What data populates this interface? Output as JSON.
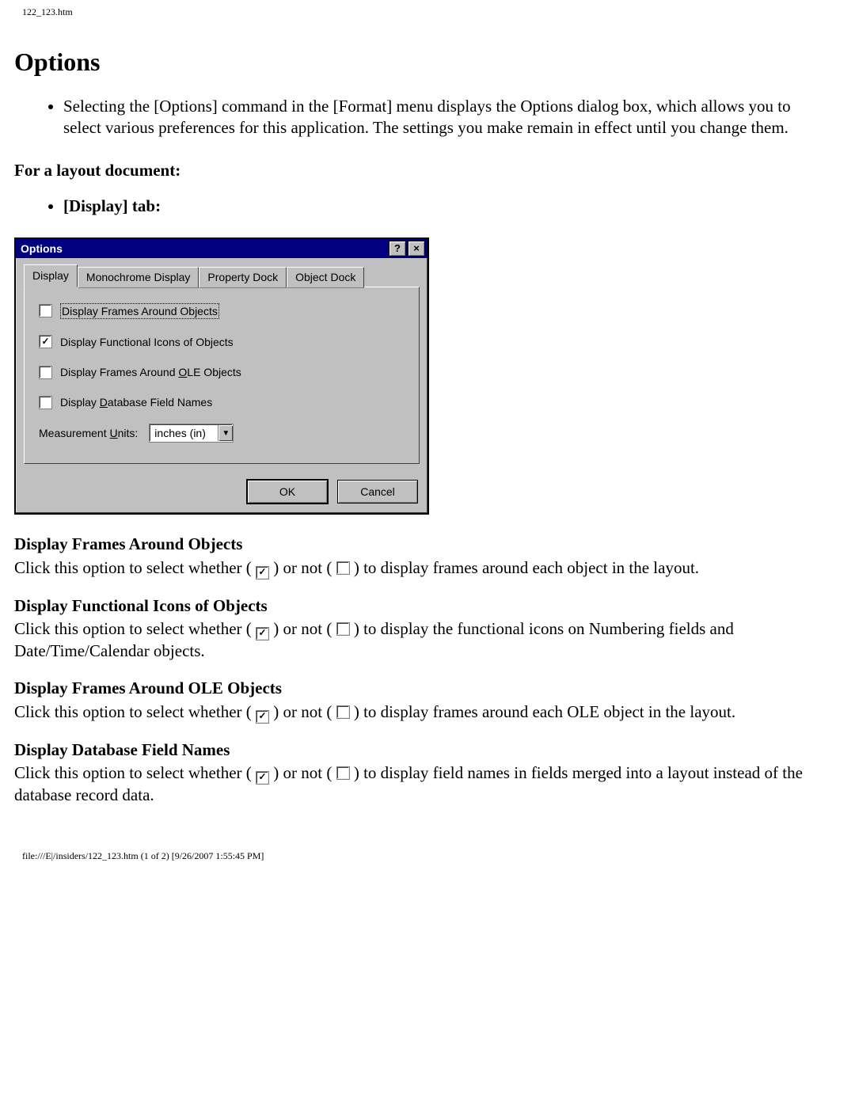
{
  "path_top": "122_123.htm",
  "title": "Options",
  "intro": "Selecting the [Options] command in the [Format] menu displays the Options dialog box, which allows you to select various preferences for this application. The settings you make remain in effect until you change them.",
  "subhead": "For a layout document:",
  "bullet_tab": "[Display] tab:",
  "dialog": {
    "title": "Options",
    "help": "?",
    "close": "×",
    "tabs": [
      "Display",
      "Monochrome Display",
      "Property Dock",
      "Object Dock"
    ],
    "opts": {
      "frames_objects": "Display Frames Around Objects",
      "func_icons": "Display Functional Icons of Objects",
      "frames_ole_pre": "Display Frames Around ",
      "frames_ole_u": "O",
      "frames_ole_post": "LE Objects",
      "db_pre": "Display ",
      "db_u": "D",
      "db_post": "atabase Field Names"
    },
    "units_label_pre": "Measurement ",
    "units_label_u": "U",
    "units_label_post": "nits:",
    "units_value": "inches (in)",
    "ok": "OK",
    "cancel": "Cancel"
  },
  "check_mark": "✓",
  "sections": [
    {
      "h": "Display Frames Around Objects",
      "pre": "Click this option to select whether (",
      "mid": ") or not (",
      "post": ") to display frames around each object in the layout."
    },
    {
      "h": "Display Functional Icons of Objects",
      "pre": "Click this option to select whether (",
      "mid": ") or not (",
      "post": ") to display the functional icons on Numbering fields and Date/Time/Calendar objects."
    },
    {
      "h": "Display Frames Around OLE Objects",
      "pre": "Click this option to select whether (",
      "mid": ") or not (",
      "post": ") to display frames around each OLE object in the layout."
    },
    {
      "h": "Display Database Field Names",
      "pre": "Click this option to select whether (",
      "mid": ") or not (",
      "post": ") to display field names in fields merged into a layout instead of the database record data."
    }
  ],
  "footer": "file:///E|/insiders/122_123.htm (1 of 2) [9/26/2007 1:55:45 PM]"
}
